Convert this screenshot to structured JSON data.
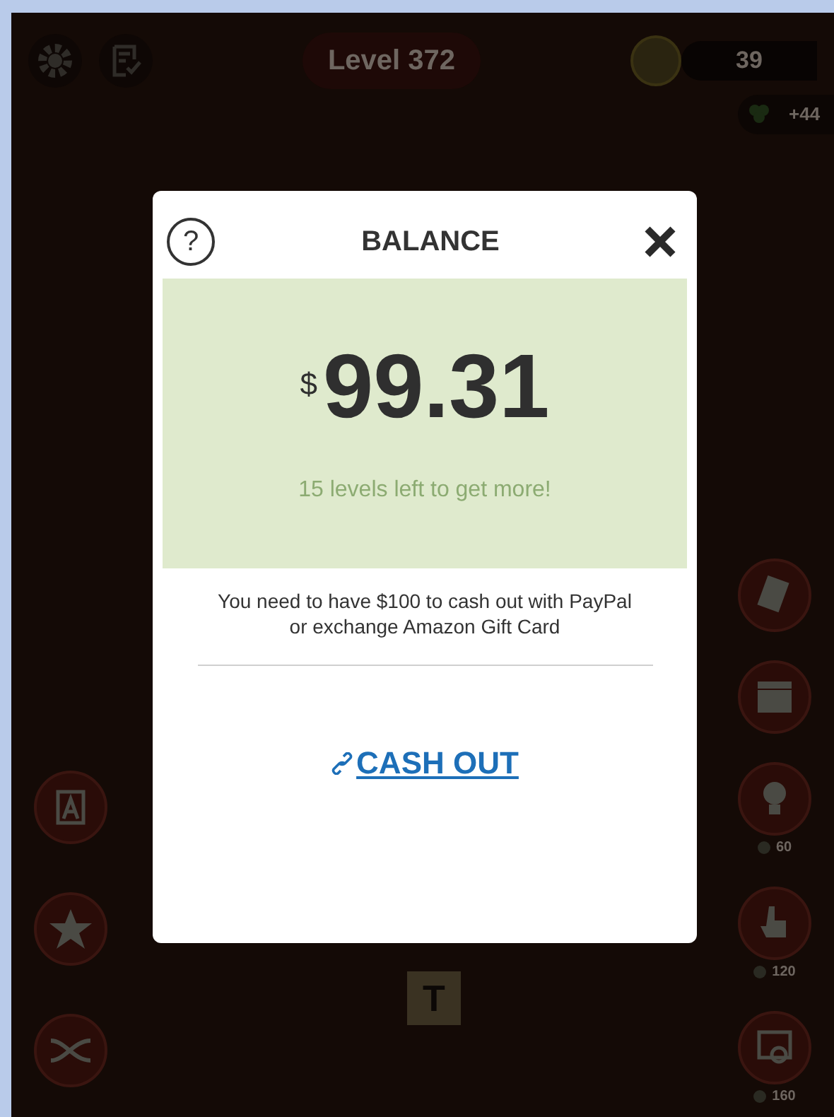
{
  "game": {
    "level": "Level 372",
    "coins": "39",
    "bonus": "+44",
    "left_tools": [
      {
        "kind": "letter"
      },
      {
        "kind": "star"
      },
      {
        "kind": "shuffle"
      }
    ],
    "right_tools": [
      {
        "kind": "cards"
      },
      {
        "kind": "video"
      },
      {
        "kind": "bulb",
        "cost": "60"
      },
      {
        "kind": "hand",
        "cost": "120"
      },
      {
        "kind": "zoom",
        "cost": "160"
      }
    ],
    "tile": "T"
  },
  "dialog": {
    "help": "?",
    "title": "BALANCE",
    "currency": "$",
    "amount": "99.31",
    "progress_note": "15 levels left to get more!",
    "info": "You need to have $100 to cash out with PayPal or exchange Amazon Gift Card",
    "link": "CASH OUT"
  }
}
